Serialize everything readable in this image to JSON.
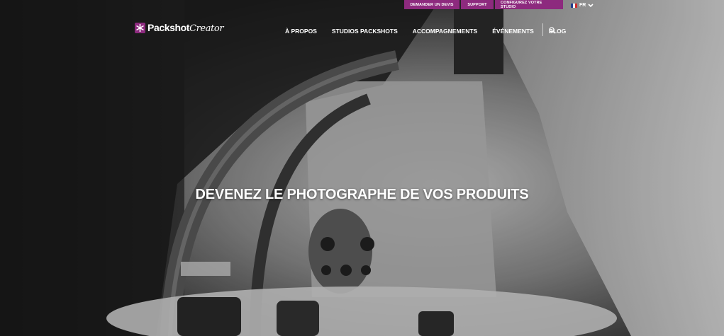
{
  "topbar": {
    "quote": "DEMANDER UN DEVIS",
    "support": "SUPPORT",
    "configure": "CONFIGUREZ VOTRE STUDIO"
  },
  "language": {
    "code": "FR",
    "flag_colors": [
      "#1f3d8f",
      "#ffffff",
      "#d22b2b"
    ]
  },
  "brand": {
    "name_bold": "Packshot",
    "name_script": "Creator",
    "accent": "#8d2a7e"
  },
  "nav": {
    "items": [
      "À PROPOS",
      "STUDIOS PACKSHOTS",
      "ACCOMPAGNEMENTS",
      "ÉVÉNEMENTS",
      "BLOG"
    ],
    "search_icon": "search-icon"
  },
  "hero": {
    "headline": "DEVENEZ LE PHOTOGRAPHE DE VOS PRODUITS"
  }
}
